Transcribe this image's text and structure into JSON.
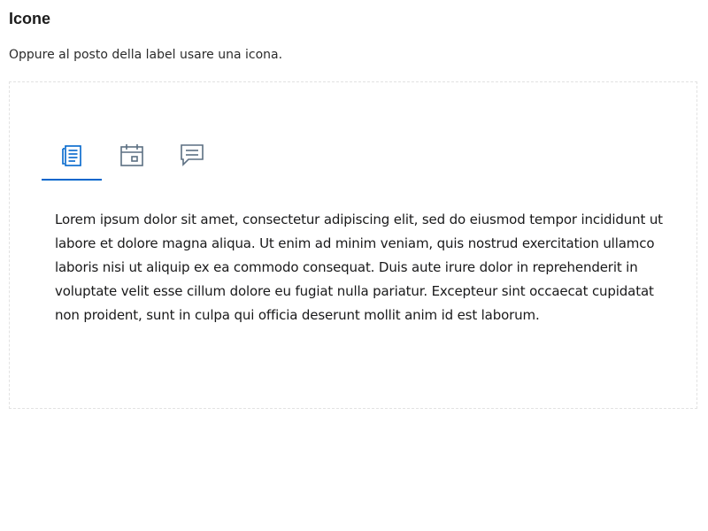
{
  "section": {
    "title": "Icone",
    "description": "Oppure al posto della label usare una icona."
  },
  "tabs": {
    "items": [
      {
        "icon": "document-icon",
        "active": true
      },
      {
        "icon": "calendar-icon",
        "active": false
      },
      {
        "icon": "comment-icon",
        "active": false
      }
    ],
    "active_color": "#0066cc",
    "inactive_color": "#5c6f82"
  },
  "panel": {
    "text": "Lorem ipsum dolor sit amet, consectetur adipiscing elit, sed do eiusmod tempor incididunt ut labore et dolore magna aliqua. Ut enim ad minim veniam, quis nostrud exercitation ullamco laboris nisi ut aliquip ex ea commodo consequat. Duis aute irure dolor in reprehenderit in voluptate velit esse cillum dolore eu fugiat nulla pariatur. Excepteur sint occaecat cupidatat non proident, sunt in culpa qui officia deserunt mollit anim id est laborum."
  }
}
